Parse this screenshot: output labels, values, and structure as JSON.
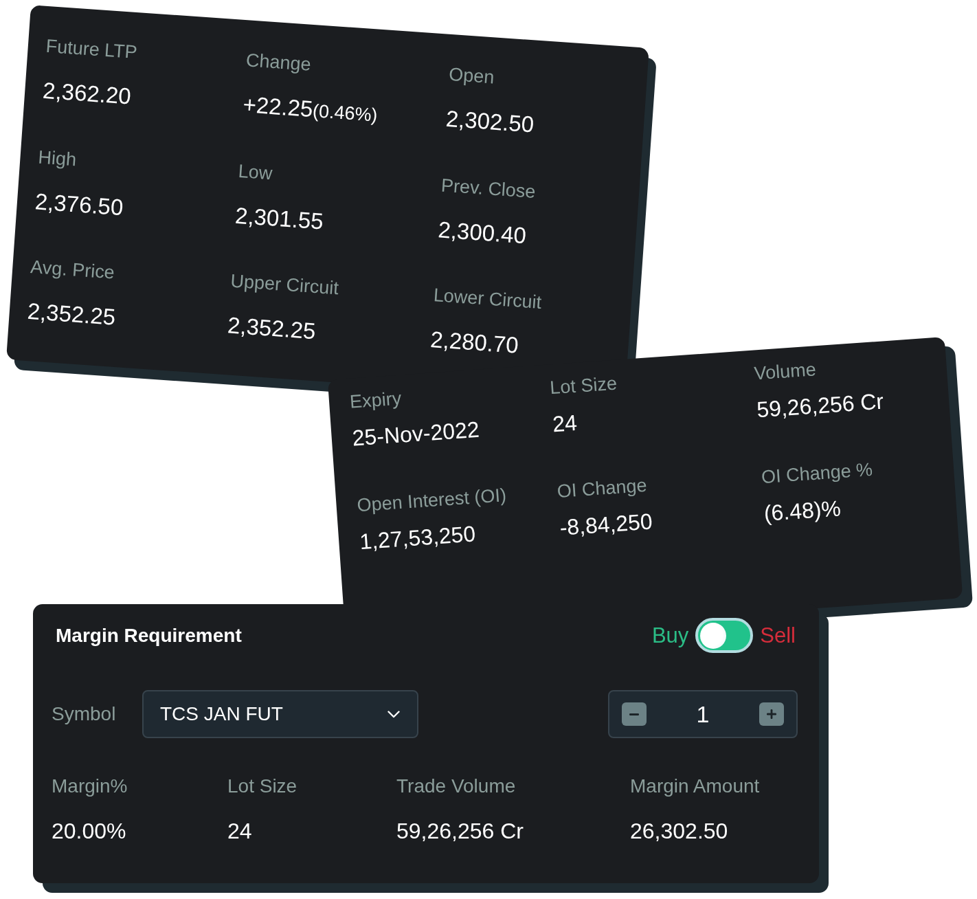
{
  "quote_card": {
    "stats": [
      {
        "label": "Future LTP",
        "value": "2,362.20"
      },
      {
        "label": "Change",
        "value": "+22.25",
        "note": "(0.46%)"
      },
      {
        "label": "Open",
        "value": "2,302.50"
      },
      {
        "label": "High",
        "value": "2,376.50"
      },
      {
        "label": "Low",
        "value": "2,301.55"
      },
      {
        "label": "Prev. Close",
        "value": "2,300.40"
      },
      {
        "label": "Avg. Price",
        "value": "2,352.25"
      },
      {
        "label": "Upper Circuit",
        "value": "2,352.25"
      },
      {
        "label": "Lower Circuit",
        "value": "2,280.70"
      }
    ]
  },
  "contract_card": {
    "stats": [
      {
        "label": "Expiry",
        "value": "25-Nov-2022"
      },
      {
        "label": "Lot Size",
        "value": "24"
      },
      {
        "label": "Volume",
        "value": "59,26,256 Cr"
      },
      {
        "label": "Open Interest (OI)",
        "value": "1,27,53,250"
      },
      {
        "label": "OI Change",
        "value": "-8,84,250"
      },
      {
        "label": "OI Change %",
        "value": "(6.48)%"
      }
    ]
  },
  "margin_card": {
    "title": "Margin Requirement",
    "side_toggle": {
      "buy": {
        "label": "Buy",
        "color": "#2bbd86"
      },
      "sell": {
        "label": "Sell",
        "color": "#d62d3b"
      },
      "on": false
    },
    "symbol": {
      "label": "Symbol",
      "value": "TCS JAN FUT"
    },
    "quantity": {
      "value": "1"
    },
    "results": [
      {
        "label": "Margin%",
        "value": "20.00%"
      },
      {
        "label": "Lot Size",
        "value": "24"
      },
      {
        "label": "Trade Volume",
        "value": "59,26,256 Cr"
      },
      {
        "label": "Margin Amount",
        "value": "26,302.50"
      }
    ]
  }
}
